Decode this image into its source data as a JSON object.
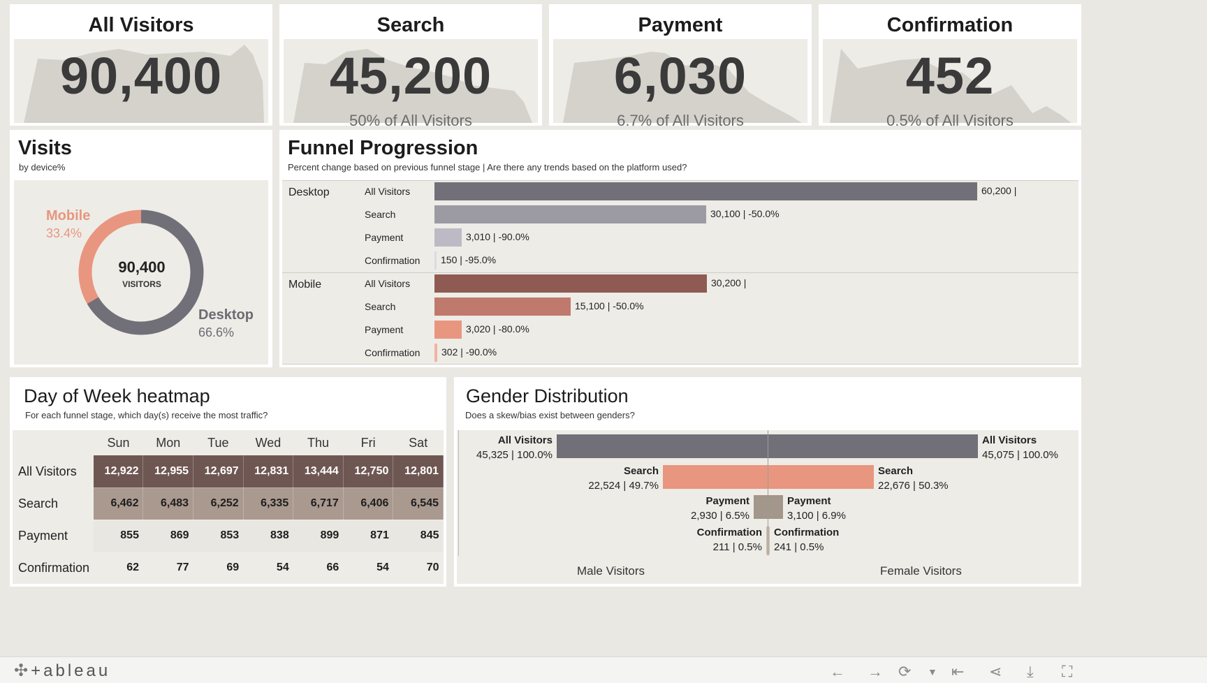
{
  "kpis": [
    {
      "title": "All Visitors",
      "value": "90,400",
      "sub": ""
    },
    {
      "title": "Search",
      "value": "45,200",
      "sub": "50% of All Visitors"
    },
    {
      "title": "Payment",
      "value": "6,030",
      "sub": "6.7% of All Visitors"
    },
    {
      "title": "Confirmation",
      "value": "452",
      "sub": "0.5% of All Visitors"
    }
  ],
  "visits": {
    "title": "Visits",
    "subtitle": "by device%",
    "center_value": "90,400",
    "center_label": "VISITORS",
    "mobile_label": "Mobile",
    "mobile_pct": "33.4%",
    "desktop_label": "Desktop",
    "desktop_pct": "66.6%",
    "mobile_fraction": 0.334,
    "colors": {
      "mobile": "#e8967f",
      "desktop": "#717078"
    }
  },
  "funnel": {
    "title": "Funnel Progression",
    "subtitle": "Percent change based on previous funnel stage | Are there any trends based on the platform used?",
    "max_value": 60200,
    "groups": [
      {
        "platform": "Desktop",
        "rows": [
          {
            "stage": "All Visitors",
            "value": 60200,
            "label": "60,200 |",
            "color": "#717078"
          },
          {
            "stage": "Search",
            "value": 30100,
            "label": "30,100 | -50.0%",
            "color": "#9c9aa2"
          },
          {
            "stage": "Payment",
            "value": 3010,
            "label": "3,010 | -90.0%",
            "color": "#bcbac4"
          },
          {
            "stage": "Confirmation",
            "value": 150,
            "label": "150 | -95.0%",
            "color": "#dcdae2"
          }
        ]
      },
      {
        "platform": "Mobile",
        "rows": [
          {
            "stage": "All Visitors",
            "value": 30200,
            "label": "30,200 |",
            "color": "#8e5a52"
          },
          {
            "stage": "Search",
            "value": 15100,
            "label": "15,100 | -50.0%",
            "color": "#c0796d"
          },
          {
            "stage": "Payment",
            "value": 3020,
            "label": "3,020 | -80.0%",
            "color": "#e8967f"
          },
          {
            "stage": "Confirmation",
            "value": 302,
            "label": "302 | -90.0%",
            "color": "#f2b3a3"
          }
        ]
      }
    ]
  },
  "heatmap": {
    "title": "Day of Week heatmap",
    "subtitle": "For each funnel stage, which day(s) receive the most traffic?",
    "days": [
      "Sun",
      "Mon",
      "Tue",
      "Wed",
      "Thu",
      "Fri",
      "Sat"
    ],
    "rows": [
      {
        "label": "All Visitors",
        "cells": [
          "12,922",
          "12,955",
          "12,697",
          "12,831",
          "13,444",
          "12,750",
          "12,801"
        ]
      },
      {
        "label": "Search",
        "cells": [
          "6,462",
          "6,483",
          "6,252",
          "6,335",
          "6,717",
          "6,406",
          "6,545"
        ]
      },
      {
        "label": "Payment",
        "cells": [
          "855",
          "869",
          "853",
          "838",
          "899",
          "871",
          "845"
        ]
      },
      {
        "label": "Confirmation",
        "cells": [
          "62",
          "77",
          "69",
          "54",
          "66",
          "54",
          "70"
        ]
      }
    ]
  },
  "gender": {
    "title": "Gender Distribution",
    "subtitle": "Does a skew/bias exist between genders?",
    "male_axis_label": "Male Visitors",
    "female_axis_label": "Female Visitors",
    "max_value": 45325,
    "rows": [
      {
        "stage": "All Visitors",
        "male_value": 45325,
        "male_text": "45,325 | 100.0%",
        "female_value": 45075,
        "female_text": "45,075 | 100.0%",
        "color": "#717078"
      },
      {
        "stage": "Search",
        "male_value": 22524,
        "male_text": "22,524 | 49.7%",
        "female_value": 22676,
        "female_text": "22,676 | 50.3%",
        "color": "#e8967f"
      },
      {
        "stage": "Payment",
        "male_value": 2930,
        "male_text": "2,930 | 6.5%",
        "female_value": 3100,
        "female_text": "3,100 | 6.9%",
        "color": "#a3968a"
      },
      {
        "stage": "Confirmation",
        "male_value": 211,
        "male_text": "211 | 0.5%",
        "female_value": 241,
        "female_text": "241 | 0.5%",
        "color": "#c9bdb0"
      }
    ]
  },
  "footer": {
    "logo_text": "+ableau"
  }
}
